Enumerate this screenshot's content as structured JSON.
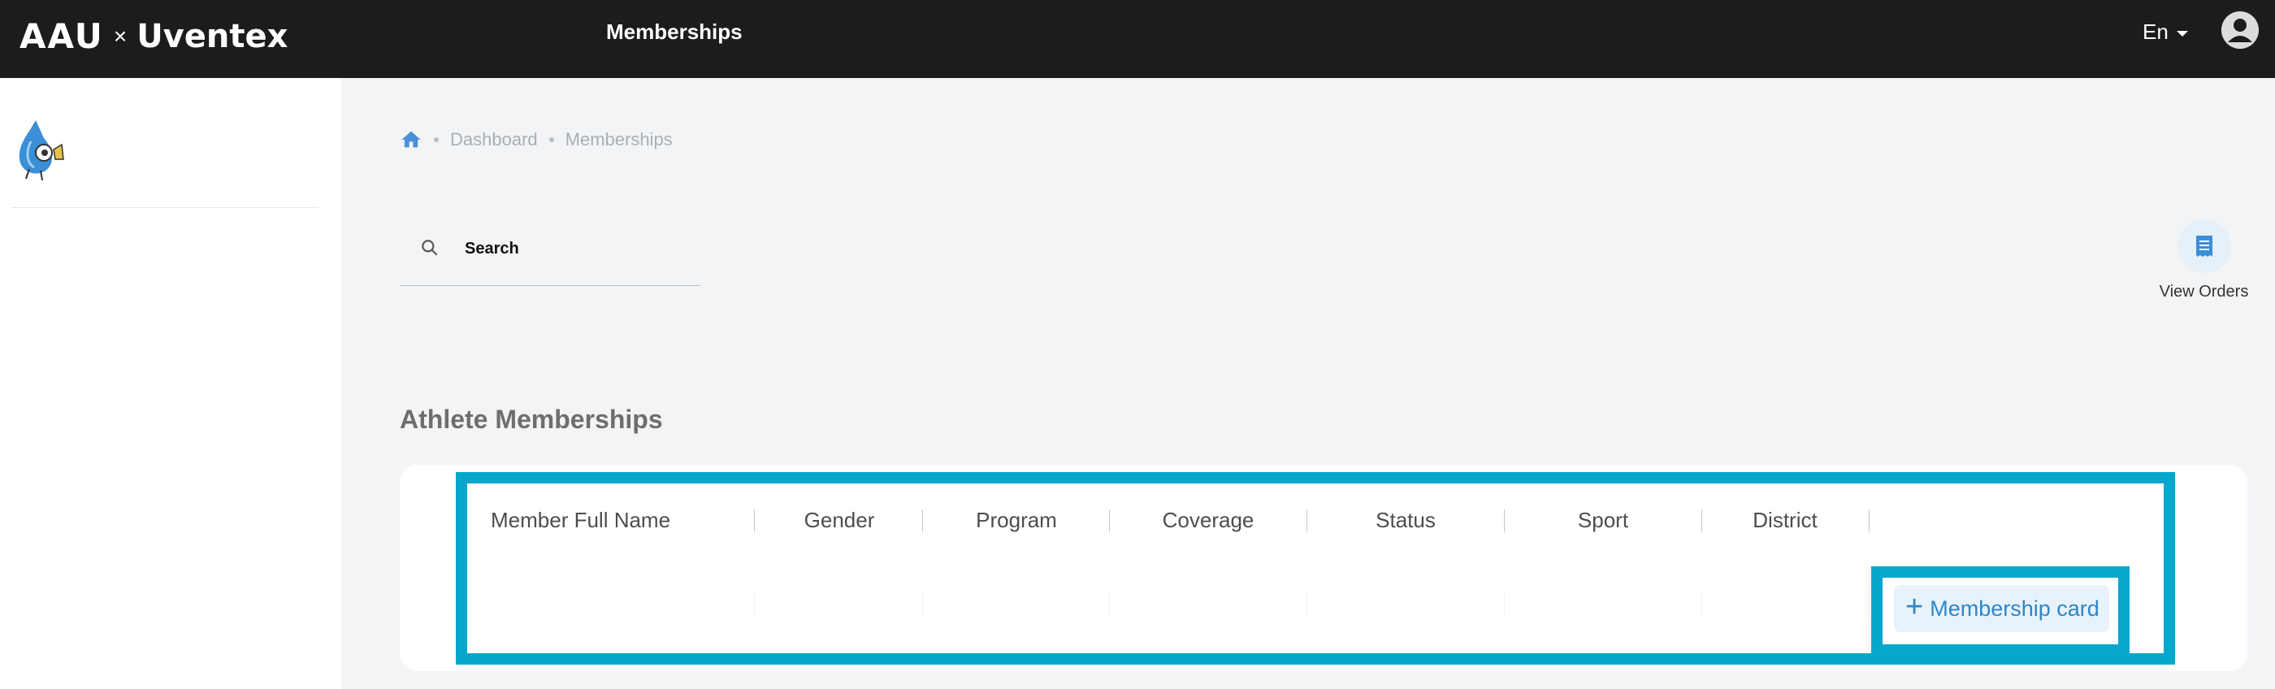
{
  "topbar": {
    "logo_left": "AAU",
    "logo_x": "×",
    "logo_right": "Uventex",
    "title": "Memberships",
    "language": "En",
    "account_icon": "account-circle-icon"
  },
  "sidebar": {
    "mascot_icon": "mascot-logo-icon"
  },
  "breadcrumb": {
    "home_icon": "home-icon",
    "items": [
      "Dashboard",
      "Memberships"
    ]
  },
  "search": {
    "placeholder": "Search",
    "value": ""
  },
  "view_orders": {
    "label": "View Orders",
    "icon": "receipt-icon"
  },
  "section": {
    "title": "Athlete Memberships"
  },
  "table": {
    "columns": [
      "Member Full Name",
      "Gender",
      "Program",
      "Coverage",
      "Status",
      "Sport",
      "District"
    ]
  },
  "actions": {
    "membership_card_label": "Membership card",
    "plus_icon": "plus-icon"
  },
  "colors": {
    "accent": "#2f86c6",
    "highlight": "#07a7cc",
    "topbar": "#1c1c1c"
  }
}
